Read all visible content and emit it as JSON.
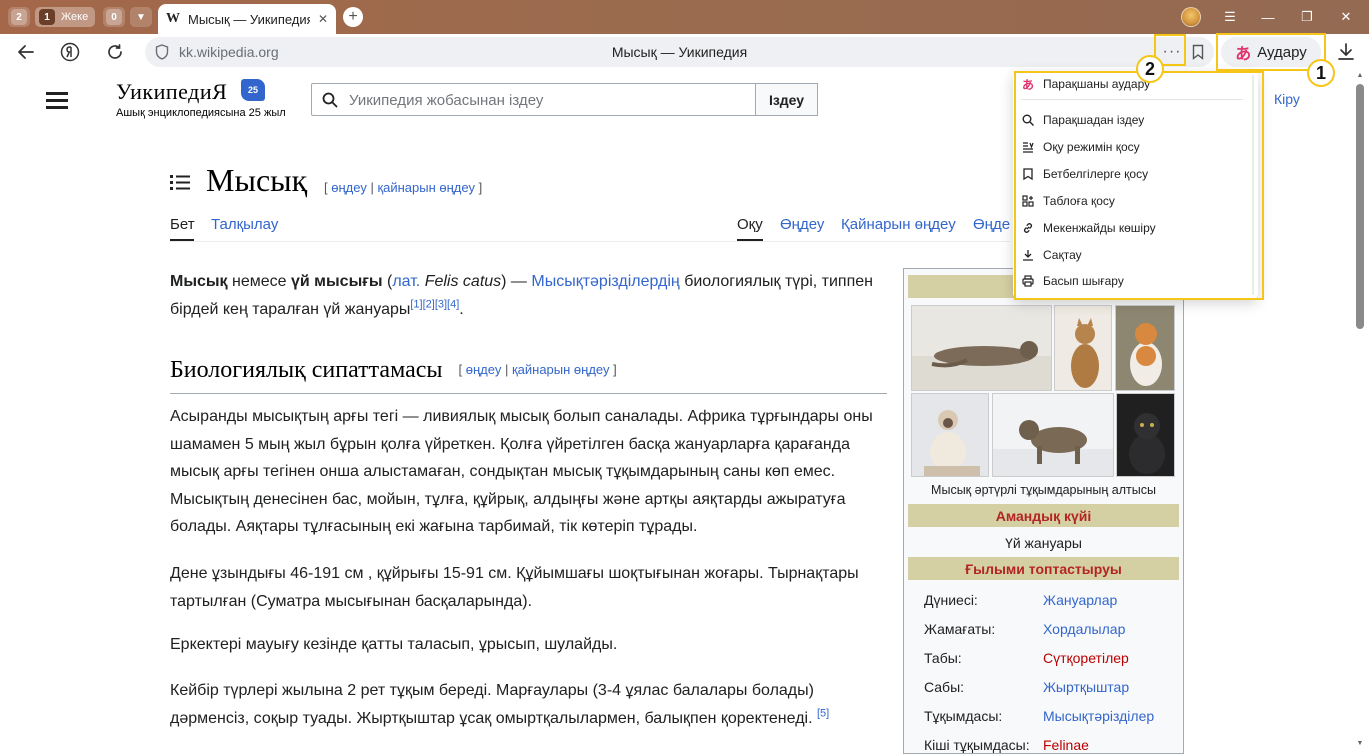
{
  "browser": {
    "tab_counters": [
      "2",
      "1",
      "0"
    ],
    "group_label": "Жеке",
    "active_tab": {
      "favicon": "W",
      "title": "Мысық — Уикипедия",
      "close": "✕"
    },
    "new_tab": "+",
    "window_controls": [
      "☰",
      "—",
      "❐",
      "✕"
    ],
    "address": {
      "url": "kk.wikipedia.org",
      "page_title": "Мысық — Уикипедия"
    },
    "menu_dots": "···",
    "translate_label": "Аудару",
    "icons": [
      "back-arrow-icon",
      "yandex-logo-icon",
      "reload-icon",
      "shield-icon",
      "bookmark-icon",
      "download-icon",
      "translate-icon"
    ]
  },
  "annotations": {
    "callout_1": "1",
    "callout_2": "2",
    "highlight_color": "#f5c518"
  },
  "dropdown": {
    "items": [
      {
        "icon": "translate-icon",
        "label": "Парақшаны аудару"
      },
      {
        "icon": "search-icon",
        "label": "Парақшадан іздеу"
      },
      {
        "icon": "reader-mode-icon",
        "label": "Оқу режимін қосу"
      },
      {
        "icon": "bookmark-icon",
        "label": "Бетбелгілерге қосу"
      },
      {
        "icon": "tableau-icon",
        "label": "Таблоға қосу"
      },
      {
        "icon": "link-icon",
        "label": "Мекенжайды көшіру"
      },
      {
        "icon": "download-icon",
        "label": "Сақтау"
      },
      {
        "icon": "printer-icon",
        "label": "Басып шығару"
      }
    ]
  },
  "wiki": {
    "logo_word": "УикипедиЯ",
    "logo_badge": "25",
    "logo_tagline": "Ашық энциклопедиясына 25 жыл",
    "search_placeholder": "Уикипедия жобасынан іздеу",
    "search_button": "Іздеу",
    "login": "Кіру",
    "title": "Мысық",
    "title_edit": "өңдеу",
    "title_source_edit": "қайнарын өңдеу",
    "tabs_left": [
      "Бет",
      "Талқылау"
    ],
    "tabs_right": [
      "Оқу",
      "Өңдеу",
      "Қайнарын өңдеу",
      "Өңде"
    ],
    "intro": {
      "b1": "Мысық",
      "t1": " немесе ",
      "b2": "үй мысығы",
      "t2": " (",
      "lat": "лат.",
      "latin": "Felis catus",
      "t3": ") — ",
      "link": "Мысықтәрізділердің",
      "t4": " биологиялық түрі, типпен бірдей кең таралған үй жануары",
      "refs": "[1][2][3][4]",
      "end": "."
    },
    "section_heading": "Биологиялық сипаттамасы",
    "section_edit": "өңдеу",
    "section_source_edit": "қайнарын өңдеу",
    "p1": "Асыранды мысықтың арғы тегі — ливиялық мысық болып саналады. Африка тұрғындары оны шамамен 5 мың жыл бұрын қолға үйреткен. Қолға үйретілген басқа жануарларға қарағанда мысық арғы тегінен онша алыстамаған, сондықтан мысық тұқымдарының саны көп емес. Мысықтың денесінен бас, мойын, тұлға, құйрық, алдыңғы және артқы аяқтарды ажыратуға болады. Аяқтары тұлғасының екі жағына тарбимай, тік көтеріп тұрады.",
    "p2": "Дене ұзындығы 46-191 см , құйрығы 15-91 см. Құйымшағы шоқтығынан жоғары. Тырнақтары тартылған (Суматра мысығынан басқаларында).",
    "p3": "Еркектері мауығу кезінде қатты таласып, ұрысып, шулайды.",
    "p4": "Кейбір түрлері жылына 2 рет тұқым береді. Марғаулары (3-4 ұялас балалары болады) дәрменсіз, соқыр туады. Жыртқыштар ұсақ омыртқалылармен, балықпен қоректенеді.",
    "p4_ref": "[5]",
    "infobox": {
      "caption": "Мысық әртүрлі тұқымдарының алтысы",
      "status_header": "Амандық күйі",
      "status_value": "Үй жануары",
      "taxonomy_header": "Ғылыми топтастыруы",
      "rows": [
        {
          "k": "Дүниесі:",
          "v": "Жануарлар"
        },
        {
          "k": "Жамағаты:",
          "v": "Хордалылар"
        },
        {
          "k": "Табы:",
          "v": "Сүтқоретілер"
        },
        {
          "k": "Сабы:",
          "v": "Жыртқыштар"
        },
        {
          "k": "Тұқымдасы:",
          "v": "Мысықтәрізділер"
        },
        {
          "k": "Кіші тұқымдасы:",
          "v": "Felinae"
        }
      ]
    }
  }
}
